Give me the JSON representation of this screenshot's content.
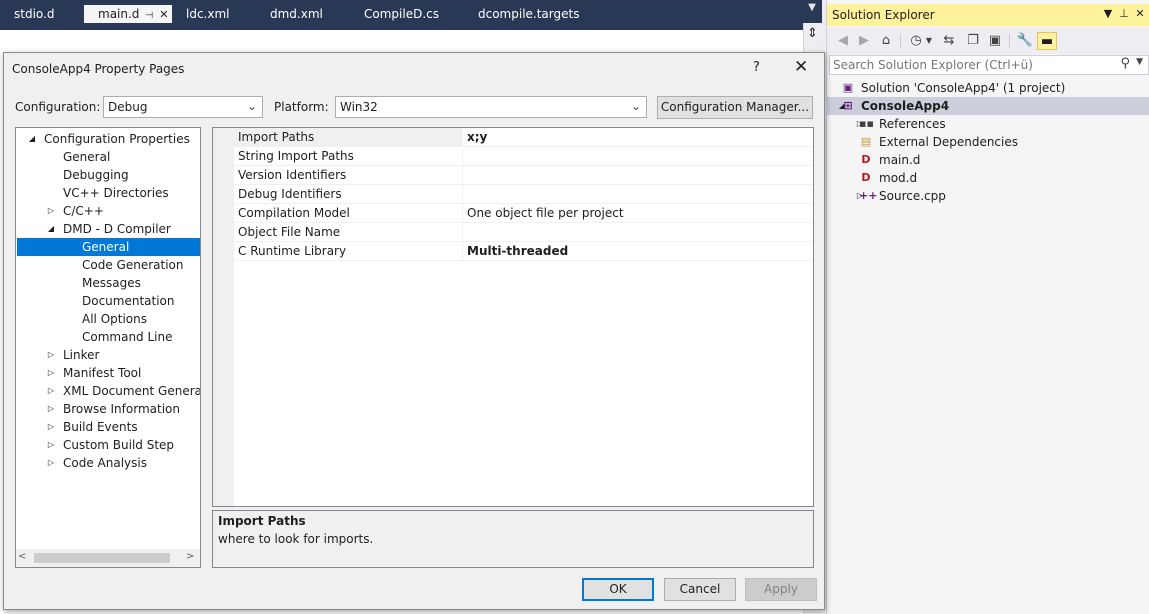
{
  "ide": {
    "doc_tabs": [
      {
        "label": "stdio.d"
      },
      {
        "label": "main.d",
        "active": true,
        "pin": "⊣",
        "close": "✕"
      },
      {
        "label": "ldc.xml"
      },
      {
        "label": "dmd.xml"
      },
      {
        "label": "CompileD.cs"
      },
      {
        "label": "dcompile.targets"
      }
    ],
    "overflow_glyph": "▼"
  },
  "solution_explorer": {
    "title": "Solution Explorer",
    "search_placeholder": "Search Solution Explorer (Ctrl+ü)",
    "toolbar_icons": [
      "back-icon",
      "forward-icon",
      "home-icon",
      "history-icon",
      "sync-icon",
      "collapse-all-icon",
      "show-all-files-icon",
      "properties-icon",
      "preview-icon"
    ],
    "tree": [
      {
        "label": "Solution 'ConsoleApp4' (1 project)",
        "icon": "solution-icon",
        "level": 0,
        "expander": ""
      },
      {
        "label": "ConsoleApp4",
        "icon": "project-icon",
        "level": 0,
        "expander": "◢",
        "selected": true
      },
      {
        "label": "References",
        "icon": "references-icon",
        "level": 1,
        "expander": "▷"
      },
      {
        "label": "External Dependencies",
        "icon": "external-deps-icon",
        "level": 1,
        "expander": ""
      },
      {
        "label": "main.d",
        "icon": "d-file-icon",
        "level": 1,
        "expander": ""
      },
      {
        "label": "mod.d",
        "icon": "d-file-icon",
        "level": 1,
        "expander": ""
      },
      {
        "label": "Source.cpp",
        "icon": "cpp-file-icon",
        "level": 1,
        "expander": "▷"
      }
    ]
  },
  "dialog": {
    "title": "ConsoleApp4 Property Pages",
    "help": "?",
    "close": "✕",
    "configuration_label": "Configuration:",
    "configuration_value": "Debug",
    "platform_label": "Platform:",
    "platform_value": "Win32",
    "config_manager_label": "Configuration Manager...",
    "nav_tree": [
      {
        "label": "Configuration Properties",
        "level": 0,
        "expander": "◢"
      },
      {
        "label": "General",
        "level": 1,
        "expander": ""
      },
      {
        "label": "Debugging",
        "level": 1,
        "expander": ""
      },
      {
        "label": "VC++ Directories",
        "level": 1,
        "expander": ""
      },
      {
        "label": "C/C++",
        "level": 1,
        "expander": "▷"
      },
      {
        "label": "DMD - D Compiler",
        "level": 1,
        "expander": "◢"
      },
      {
        "label": "General",
        "level": 2,
        "expander": "",
        "selected": true
      },
      {
        "label": "Code Generation",
        "level": 2,
        "expander": ""
      },
      {
        "label": "Messages",
        "level": 2,
        "expander": ""
      },
      {
        "label": "Documentation",
        "level": 2,
        "expander": ""
      },
      {
        "label": "All Options",
        "level": 2,
        "expander": ""
      },
      {
        "label": "Command Line",
        "level": 2,
        "expander": ""
      },
      {
        "label": "Linker",
        "level": 1,
        "expander": "▷"
      },
      {
        "label": "Manifest Tool",
        "level": 1,
        "expander": "▷"
      },
      {
        "label": "XML Document Generator",
        "level": 1,
        "expander": "▷"
      },
      {
        "label": "Browse Information",
        "level": 1,
        "expander": "▷"
      },
      {
        "label": "Build Events",
        "level": 1,
        "expander": "▷"
      },
      {
        "label": "Custom Build Step",
        "level": 1,
        "expander": "▷"
      },
      {
        "label": "Code Analysis",
        "level": 1,
        "expander": "▷"
      }
    ],
    "properties": [
      {
        "name": "Import Paths",
        "value": "x;y",
        "bold": true,
        "selected": true
      },
      {
        "name": "String Import Paths",
        "value": ""
      },
      {
        "name": "Version Identifiers",
        "value": ""
      },
      {
        "name": "Debug Identifiers",
        "value": ""
      },
      {
        "name": "Compilation Model",
        "value": "One object file per project"
      },
      {
        "name": "Object File Name",
        "value": ""
      },
      {
        "name": "C Runtime Library",
        "value": "Multi-threaded",
        "bold": true
      }
    ],
    "description_title": "Import Paths",
    "description_text": "where to look for imports.",
    "buttons": {
      "ok": "OK",
      "cancel": "Cancel",
      "apply": "Apply"
    }
  }
}
